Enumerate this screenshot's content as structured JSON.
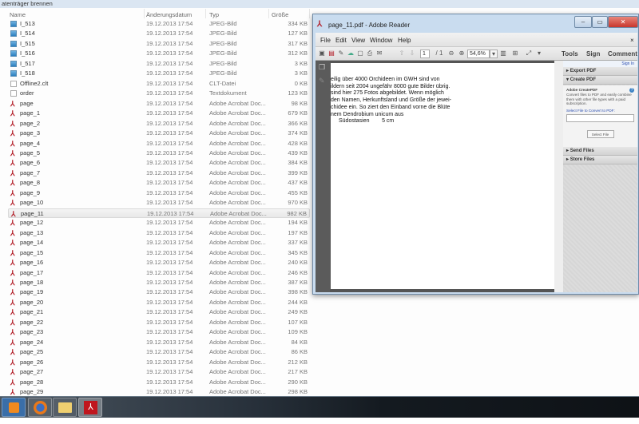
{
  "explorer": {
    "top_label": "atenträger brennen",
    "columns": {
      "name": "Name",
      "date": "Änderungsdatum",
      "type": "Typ",
      "size": "Größe"
    },
    "selected_index": 22,
    "files": [
      {
        "name": "I_513",
        "date": "19.12.2013 17:54",
        "type": "JPEG-Bild",
        "size": "334 KB",
        "icon": "jpeg-icon"
      },
      {
        "name": "I_514",
        "date": "19.12.2013 17:54",
        "type": "JPEG-Bild",
        "size": "127 KB",
        "icon": "jpeg-icon"
      },
      {
        "name": "I_515",
        "date": "19.12.2013 17:54",
        "type": "JPEG-Bild",
        "size": "317 KB",
        "icon": "jpeg-icon"
      },
      {
        "name": "I_516",
        "date": "19.12.2013 17:54",
        "type": "JPEG-Bild",
        "size": "312 KB",
        "icon": "jpeg-icon"
      },
      {
        "name": "I_517",
        "date": "19.12.2013 17:54",
        "type": "JPEG-Bild",
        "size": "3 KB",
        "icon": "jpeg-icon"
      },
      {
        "name": "I_518",
        "date": "19.12.2013 17:54",
        "type": "JPEG-Bild",
        "size": "3 KB",
        "icon": "jpeg-icon"
      },
      {
        "name": "Offline2.clt",
        "date": "19.12.2013 17:54",
        "type": "CLT-Datei",
        "size": "0 KB",
        "icon": "file-icon"
      },
      {
        "name": "order",
        "date": "19.12.2013 17:54",
        "type": "Textdokument",
        "size": "123 KB",
        "icon": "file-icon"
      },
      {
        "name": "page",
        "date": "19.12.2013 17:54",
        "type": "Adobe Acrobat Doc...",
        "size": "98 KB",
        "icon": "pdf-icon"
      },
      {
        "name": "page_1",
        "date": "19.12.2013 17:54",
        "type": "Adobe Acrobat Doc...",
        "size": "679 KB",
        "icon": "pdf-icon"
      },
      {
        "name": "page_2",
        "date": "19.12.2013 17:54",
        "type": "Adobe Acrobat Doc...",
        "size": "366 KB",
        "icon": "pdf-icon"
      },
      {
        "name": "page_3",
        "date": "19.12.2013 17:54",
        "type": "Adobe Acrobat Doc...",
        "size": "374 KB",
        "icon": "pdf-icon"
      },
      {
        "name": "page_4",
        "date": "19.12.2013 17:54",
        "type": "Adobe Acrobat Doc...",
        "size": "428 KB",
        "icon": "pdf-icon"
      },
      {
        "name": "page_5",
        "date": "19.12.2013 17:54",
        "type": "Adobe Acrobat Doc...",
        "size": "439 KB",
        "icon": "pdf-icon"
      },
      {
        "name": "page_6",
        "date": "19.12.2013 17:54",
        "type": "Adobe Acrobat Doc...",
        "size": "384 KB",
        "icon": "pdf-icon"
      },
      {
        "name": "page_7",
        "date": "19.12.2013 17:54",
        "type": "Adobe Acrobat Doc...",
        "size": "399 KB",
        "icon": "pdf-icon"
      },
      {
        "name": "page_8",
        "date": "19.12.2013 17:54",
        "type": "Adobe Acrobat Doc...",
        "size": "437 KB",
        "icon": "pdf-icon"
      },
      {
        "name": "page_9",
        "date": "19.12.2013 17:54",
        "type": "Adobe Acrobat Doc...",
        "size": "455 KB",
        "icon": "pdf-icon"
      },
      {
        "name": "page_10",
        "date": "19.12.2013 17:54",
        "type": "Adobe Acrobat Doc...",
        "size": "970 KB",
        "icon": "pdf-icon"
      },
      {
        "name": "page_11",
        "date": "19.12.2013 17:54",
        "type": "Adobe Acrobat Doc...",
        "size": "982 KB",
        "icon": "pdf-icon"
      },
      {
        "name": "page_12",
        "date": "19.12.2013 17:54",
        "type": "Adobe Acrobat Doc...",
        "size": "194 KB",
        "icon": "pdf-icon"
      },
      {
        "name": "page_13",
        "date": "19.12.2013 17:54",
        "type": "Adobe Acrobat Doc...",
        "size": "197 KB",
        "icon": "pdf-icon"
      },
      {
        "name": "page_14",
        "date": "19.12.2013 17:54",
        "type": "Adobe Acrobat Doc...",
        "size": "337 KB",
        "icon": "pdf-icon"
      },
      {
        "name": "page_15",
        "date": "19.12.2013 17:54",
        "type": "Adobe Acrobat Doc...",
        "size": "345 KB",
        "icon": "pdf-icon"
      },
      {
        "name": "page_16",
        "date": "19.12.2013 17:54",
        "type": "Adobe Acrobat Doc...",
        "size": "240 KB",
        "icon": "pdf-icon"
      },
      {
        "name": "page_17",
        "date": "19.12.2013 17:54",
        "type": "Adobe Acrobat Doc...",
        "size": "246 KB",
        "icon": "pdf-icon"
      },
      {
        "name": "page_18",
        "date": "19.12.2013 17:54",
        "type": "Adobe Acrobat Doc...",
        "size": "387 KB",
        "icon": "pdf-icon"
      },
      {
        "name": "page_19",
        "date": "19.12.2013 17:54",
        "type": "Adobe Acrobat Doc...",
        "size": "398 KB",
        "icon": "pdf-icon"
      },
      {
        "name": "page_20",
        "date": "19.12.2013 17:54",
        "type": "Adobe Acrobat Doc...",
        "size": "244 KB",
        "icon": "pdf-icon"
      },
      {
        "name": "page_21",
        "date": "19.12.2013 17:54",
        "type": "Adobe Acrobat Doc...",
        "size": "249 KB",
        "icon": "pdf-icon"
      },
      {
        "name": "page_22",
        "date": "19.12.2013 17:54",
        "type": "Adobe Acrobat Doc...",
        "size": "107 KB",
        "icon": "pdf-icon"
      },
      {
        "name": "page_23",
        "date": "19.12.2013 17:54",
        "type": "Adobe Acrobat Doc...",
        "size": "109 KB",
        "icon": "pdf-icon"
      },
      {
        "name": "page_24",
        "date": "19.12.2013 17:54",
        "type": "Adobe Acrobat Doc...",
        "size": "84 KB",
        "icon": "pdf-icon"
      },
      {
        "name": "page_25",
        "date": "19.12.2013 17:54",
        "type": "Adobe Acrobat Doc...",
        "size": "86 KB",
        "icon": "pdf-icon"
      },
      {
        "name": "page_26",
        "date": "19.12.2013 17:54",
        "type": "Adobe Acrobat Doc...",
        "size": "212 KB",
        "icon": "pdf-icon"
      },
      {
        "name": "page_27",
        "date": "19.12.2013 17:54",
        "type": "Adobe Acrobat Doc...",
        "size": "217 KB",
        "icon": "pdf-icon"
      },
      {
        "name": "page_28",
        "date": "19.12.2013 17:54",
        "type": "Adobe Acrobat Doc...",
        "size": "290 KB",
        "icon": "pdf-icon"
      },
      {
        "name": "page_29",
        "date": "19.12.2013 17:54",
        "type": "Adobe Acrobat Doc...",
        "size": "298 KB",
        "icon": "pdf-icon"
      }
    ]
  },
  "reader": {
    "title": "page_11.pdf - Adobe Reader",
    "menu": [
      "File",
      "Edit",
      "View",
      "Window",
      "Help"
    ],
    "page_current": "1",
    "page_total": "/ 1",
    "zoom": "54,6%",
    "right_tools": [
      "Tools",
      "Sign",
      "Comment"
    ],
    "page_text": [
      "eilig über 4000 Orchideen im GWH sind von",
      "ildern seit 2004 ungefähr 8000 gute Bilder übrig.",
      "sind hier 275 Fotos abgebildet. Wenn möglich",
      "den Namen, Herkunftsland und Größe der jewei-",
      "chidee ein. So ziert den Einband vorne die Blüte",
      "nem Dendrobium unicum aus",
      "Südostasien        5 cm"
    ],
    "pane": {
      "sign_in": "Sign In",
      "export": "Export PDF",
      "create": "Create PDF",
      "create_title": "Adobe CreatePDF",
      "create_desc": "Convert files to PDF and easily combine them with other file types with a paid subscription.",
      "select_label": "Select File to Convert to PDF:",
      "select_button": "Select File",
      "send": "Send Files",
      "store": "Store Files"
    }
  },
  "colors": {
    "pdf_red": "#b3202a",
    "close_red": "#c8372d",
    "link_blue": "#2a4db0"
  }
}
